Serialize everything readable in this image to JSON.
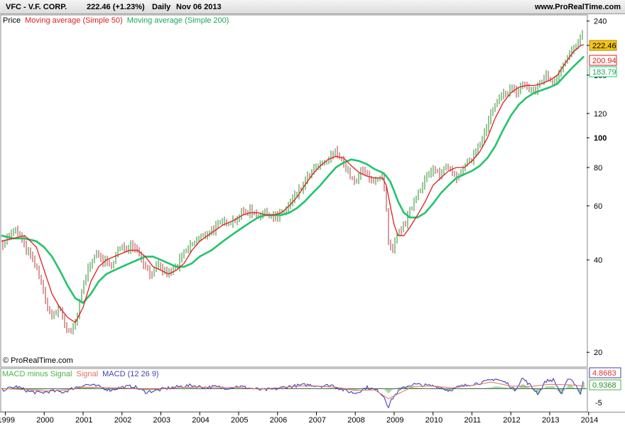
{
  "header": {
    "symbol": "VFC - V.F. CORP.",
    "quote": "222.46 (+1.23%)",
    "period": "Daily",
    "date": "Nov 06 2013",
    "site": "www.ProRealTime.com"
  },
  "price_panel": {
    "legend": [
      "Price",
      "Moving average (Simple 50)",
      "Moving average (Simple 200)"
    ],
    "copyright": "© ProRealTime.com",
    "last_price": "222.46",
    "last_ma50": "200.94",
    "last_ma200": "183.79"
  },
  "macd_panel": {
    "legend": [
      "MACD minus Signal",
      "Signal",
      "MACD (12 26 9)"
    ],
    "last_macd": "4.8683",
    "last_signal": "0.9368"
  },
  "colors": {
    "price_up": "#2a8c2a",
    "price_down": "#b03a3a",
    "ma50": "#dd1f1f",
    "ma200": "#22c46a",
    "macd": "#4040b0",
    "signal": "#e07060",
    "histogram": "#49b349",
    "last_price_bg": "#f5c518"
  },
  "chart_data": [
    {
      "type": "line",
      "scale": "log",
      "y_ticks": [
        20,
        40,
        60,
        80,
        100,
        120,
        160,
        200,
        240
      ],
      "x_ticks": [
        "1999",
        "2000",
        "2001",
        "2002",
        "2003",
        "2004",
        "2005",
        "2006",
        "2007",
        "2008",
        "2009",
        "2010",
        "2011",
        "2012",
        "2013",
        "2014"
      ],
      "ylim": [
        18,
        250
      ],
      "xlim": [
        1998.9,
        2013.95
      ],
      "series": [
        {
          "name": "Price",
          "x": [
            1998.9,
            1999.1,
            1999.3,
            1999.5,
            1999.7,
            1999.9,
            2000.0,
            2000.2,
            2000.4,
            2000.55,
            2000.7,
            2000.85,
            2001.0,
            2001.15,
            2001.3,
            2001.5,
            2001.7,
            2001.9,
            2002.1,
            2002.3,
            2002.45,
            2002.6,
            2002.75,
            2002.9,
            2003.05,
            2003.2,
            2003.4,
            2003.6,
            2003.8,
            2004.0,
            2004.3,
            2004.6,
            2004.9,
            2005.1,
            2005.3,
            2005.5,
            2005.7,
            2005.85,
            2006.0,
            2006.2,
            2006.4,
            2006.6,
            2006.8,
            2007.0,
            2007.2,
            2007.35,
            2007.5,
            2007.6,
            2007.7,
            2007.8,
            2007.9,
            2008.0,
            2008.1,
            2008.2,
            2008.3,
            2008.45,
            2008.6,
            2008.7,
            2008.78,
            2008.85,
            2008.95,
            2009.05,
            2009.15,
            2009.25,
            2009.35,
            2009.5,
            2009.65,
            2009.8,
            2010.0,
            2010.2,
            2010.35,
            2010.5,
            2010.65,
            2010.8,
            2011.0,
            2011.2,
            2011.35,
            2011.5,
            2011.65,
            2011.8,
            2012.0,
            2012.15,
            2012.3,
            2012.45,
            2012.6,
            2012.75,
            2012.9,
            2013.0,
            2013.1,
            2013.25,
            2013.4,
            2013.55,
            2013.7,
            2013.8,
            2013.88
          ],
          "values": [
            45,
            48,
            50,
            44,
            40,
            35,
            30,
            26,
            28,
            24,
            23,
            26,
            33,
            38,
            42,
            40,
            38,
            43,
            44,
            45,
            42,
            38,
            36,
            38,
            37,
            36,
            38,
            42,
            45,
            47,
            50,
            53,
            54,
            57,
            58,
            56,
            57,
            56,
            55,
            58,
            63,
            68,
            75,
            80,
            82,
            86,
            90,
            88,
            82,
            78,
            74,
            70,
            76,
            78,
            76,
            73,
            72,
            75,
            62,
            45,
            42,
            47,
            50,
            52,
            55,
            62,
            68,
            74,
            78,
            76,
            82,
            78,
            74,
            80,
            86,
            95,
            105,
            120,
            130,
            138,
            145,
            140,
            150,
            145,
            140,
            152,
            160,
            155,
            152,
            165,
            180,
            190,
            200,
            210,
            222
          ]
        },
        {
          "name": "Moving average (Simple 50)",
          "x": [
            1998.9,
            1999.2,
            1999.5,
            1999.8,
            2000.0,
            2000.2,
            2000.4,
            2000.6,
            2000.8,
            2001.0,
            2001.2,
            2001.4,
            2001.6,
            2001.8,
            2002.0,
            2002.2,
            2002.4,
            2002.6,
            2002.8,
            2003.0,
            2003.2,
            2003.4,
            2003.6,
            2003.8,
            2004.0,
            2004.3,
            2004.6,
            2004.9,
            2005.1,
            2005.3,
            2005.5,
            2005.7,
            2005.9,
            2006.1,
            2006.3,
            2006.5,
            2006.7,
            2006.9,
            2007.1,
            2007.3,
            2007.5,
            2007.7,
            2007.9,
            2008.1,
            2008.3,
            2008.5,
            2008.7,
            2008.8,
            2008.9,
            2009.0,
            2009.1,
            2009.25,
            2009.4,
            2009.6,
            2009.8,
            2010.0,
            2010.2,
            2010.4,
            2010.6,
            2010.8,
            2011.0,
            2011.2,
            2011.4,
            2011.6,
            2011.8,
            2012.0,
            2012.2,
            2012.4,
            2012.6,
            2012.8,
            2013.0,
            2013.2,
            2013.4,
            2013.6,
            2013.8,
            2013.88
          ],
          "values": [
            46,
            47,
            48,
            44,
            37,
            31,
            28,
            26,
            25,
            28,
            34,
            38,
            40,
            41,
            42,
            43,
            43,
            41,
            38,
            37,
            36,
            37,
            39,
            43,
            46,
            49,
            52,
            54,
            56,
            57,
            57,
            56,
            56,
            57,
            60,
            64,
            70,
            76,
            81,
            85,
            87,
            86,
            81,
            77,
            75,
            74,
            74,
            70,
            60,
            52,
            48,
            48,
            51,
            56,
            62,
            70,
            74,
            78,
            80,
            80,
            84,
            90,
            100,
            116,
            130,
            140,
            146,
            148,
            148,
            150,
            154,
            160,
            175,
            190,
            200,
            201
          ]
        },
        {
          "name": "Moving average (Simple 200)",
          "x": [
            1998.9,
            1999.2,
            1999.5,
            1999.8,
            2000.0,
            2000.2,
            2000.4,
            2000.6,
            2000.8,
            2001.0,
            2001.2,
            2001.4,
            2001.6,
            2001.8,
            2002.0,
            2002.2,
            2002.4,
            2002.6,
            2002.8,
            2003.0,
            2003.2,
            2003.4,
            2003.6,
            2003.8,
            2004.0,
            2004.3,
            2004.6,
            2004.9,
            2005.1,
            2005.3,
            2005.5,
            2005.7,
            2005.9,
            2006.1,
            2006.3,
            2006.5,
            2006.7,
            2006.9,
            2007.1,
            2007.3,
            2007.5,
            2007.7,
            2007.9,
            2008.1,
            2008.3,
            2008.5,
            2008.7,
            2008.8,
            2008.9,
            2009.0,
            2009.1,
            2009.25,
            2009.4,
            2009.6,
            2009.8,
            2010.0,
            2010.2,
            2010.4,
            2010.6,
            2010.8,
            2011.0,
            2011.2,
            2011.4,
            2011.6,
            2011.8,
            2012.0,
            2012.2,
            2012.4,
            2012.6,
            2012.8,
            2013.0,
            2013.2,
            2013.4,
            2013.6,
            2013.8,
            2013.88
          ],
          "values": [
            48,
            47,
            47,
            46,
            44,
            41,
            37,
            33,
            30,
            29,
            31,
            34,
            36,
            37,
            38,
            39,
            40,
            41,
            41,
            40,
            39,
            38,
            38,
            39,
            41,
            43,
            46,
            49,
            51,
            53,
            55,
            56,
            56,
            56,
            57,
            59,
            62,
            66,
            70,
            75,
            80,
            83,
            85,
            84,
            82,
            79,
            77,
            75,
            72,
            67,
            62,
            57,
            55,
            55,
            57,
            61,
            66,
            70,
            74,
            76,
            78,
            81,
            86,
            94,
            106,
            118,
            128,
            135,
            140,
            143,
            146,
            150,
            160,
            170,
            180,
            184
          ]
        }
      ]
    },
    {
      "type": "line",
      "y_ticks": [
        -5
      ],
      "ylim": [
        -8,
        7
      ],
      "series": [
        {
          "name": "MACD (12 26 9)",
          "x": [
            1998.9,
            1999.3,
            1999.6,
            1999.9,
            2000.2,
            2000.5,
            2000.8,
            2001.1,
            2001.4,
            2001.7,
            2002.0,
            2002.3,
            2002.6,
            2002.9,
            2003.2,
            2003.5,
            2003.8,
            2004.1,
            2004.4,
            2004.7,
            2005.0,
            2005.3,
            2005.6,
            2005.9,
            2006.2,
            2006.5,
            2006.8,
            2007.1,
            2007.4,
            2007.7,
            2008.0,
            2008.3,
            2008.6,
            2008.75,
            2008.85,
            2008.95,
            2009.1,
            2009.3,
            2009.5,
            2009.8,
            2010.1,
            2010.4,
            2010.7,
            2011.0,
            2011.3,
            2011.6,
            2011.9,
            2012.1,
            2012.3,
            2012.5,
            2012.7,
            2012.9,
            2013.1,
            2013.3,
            2013.5,
            2013.7,
            2013.8,
            2013.88
          ],
          "values": [
            -0.5,
            0.8,
            -1.0,
            -1.5,
            -0.8,
            -1.2,
            0.5,
            1.5,
            0.8,
            -0.5,
            0.6,
            0.9,
            -1.2,
            -0.6,
            0.3,
            0.8,
            1.2,
            0.5,
            0.7,
            0.3,
            0.9,
            0.2,
            -0.4,
            -0.2,
            0.6,
            1.1,
            1.4,
            1.0,
            1.3,
            -0.5,
            -1.6,
            0.5,
            -0.8,
            -3.0,
            -6.5,
            -3.5,
            -1.0,
            0.8,
            1.6,
            1.2,
            0.9,
            -0.6,
            0.8,
            1.7,
            2.3,
            3.6,
            2.0,
            -0.5,
            3.8,
            1.2,
            -1.8,
            2.8,
            3.2,
            -2.0,
            4.2,
            0.8,
            -2.5,
            4.87
          ]
        },
        {
          "name": "Signal",
          "x": [
            1998.9,
            1999.5,
            2000.0,
            2000.5,
            2001.0,
            2001.5,
            2002.0,
            2002.5,
            2003.0,
            2003.5,
            2004.0,
            2004.5,
            2005.0,
            2005.5,
            2006.0,
            2006.5,
            2007.0,
            2007.5,
            2008.0,
            2008.5,
            2008.85,
            2009.1,
            2009.5,
            2010.0,
            2010.5,
            2011.0,
            2011.5,
            2012.0,
            2012.5,
            2013.0,
            2013.5,
            2013.88
          ],
          "values": [
            0.1,
            -0.3,
            -0.8,
            -0.6,
            0.6,
            0.5,
            0.3,
            -0.2,
            -0.1,
            0.5,
            0.6,
            0.4,
            0.5,
            -0.1,
            0.3,
            0.9,
            1.0,
            0.6,
            -0.6,
            -0.4,
            -3.6,
            -1.8,
            0.8,
            1.0,
            0.3,
            1.2,
            2.4,
            1.0,
            0.8,
            1.6,
            1.4,
            0.94
          ]
        },
        {
          "name": "MACD minus Signal"
        }
      ]
    }
  ]
}
